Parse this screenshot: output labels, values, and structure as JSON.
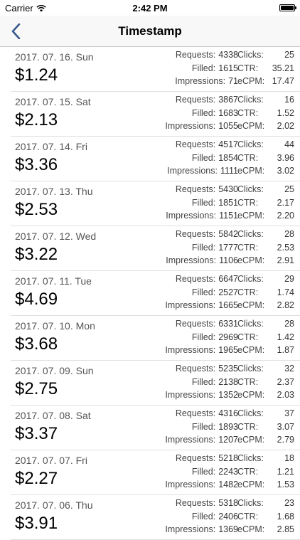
{
  "status": {
    "carrier": "Carrier",
    "time": "2:42 PM"
  },
  "nav": {
    "title": "Timestamp"
  },
  "labels": {
    "requests": "Requests:",
    "filled": "Filled:",
    "impressions": "Impressions:",
    "clicks": "Clicks:",
    "ctr": "CTR:",
    "ecpm": "eCPM:"
  },
  "rows": [
    {
      "date": "2017. 07. 16. Sun",
      "amount": "$1.24",
      "requests": "4338",
      "filled": "1615",
      "impressions": "71",
      "clicks": "25",
      "ctr": "35.21",
      "ecpm": "17.47"
    },
    {
      "date": "2017. 07. 15. Sat",
      "amount": "$2.13",
      "requests": "3867",
      "filled": "1683",
      "impressions": "1055",
      "clicks": "16",
      "ctr": "1.52",
      "ecpm": "2.02"
    },
    {
      "date": "2017. 07. 14. Fri",
      "amount": "$3.36",
      "requests": "4517",
      "filled": "1854",
      "impressions": "1111",
      "clicks": "44",
      "ctr": "3.96",
      "ecpm": "3.02"
    },
    {
      "date": "2017. 07. 13. Thu",
      "amount": "$2.53",
      "requests": "5430",
      "filled": "1851",
      "impressions": "1151",
      "clicks": "25",
      "ctr": "2.17",
      "ecpm": "2.20"
    },
    {
      "date": "2017. 07. 12. Wed",
      "amount": "$3.22",
      "requests": "5842",
      "filled": "1777",
      "impressions": "1106",
      "clicks": "28",
      "ctr": "2.53",
      "ecpm": "2.91"
    },
    {
      "date": "2017. 07. 11. Tue",
      "amount": "$4.69",
      "requests": "6647",
      "filled": "2527",
      "impressions": "1665",
      "clicks": "29",
      "ctr": "1.74",
      "ecpm": "2.82"
    },
    {
      "date": "2017. 07. 10. Mon",
      "amount": "$3.68",
      "requests": "6331",
      "filled": "2969",
      "impressions": "1965",
      "clicks": "28",
      "ctr": "1.42",
      "ecpm": "1.87"
    },
    {
      "date": "2017. 07. 09. Sun",
      "amount": "$2.75",
      "requests": "5235",
      "filled": "2138",
      "impressions": "1352",
      "clicks": "32",
      "ctr": "2.37",
      "ecpm": "2.03"
    },
    {
      "date": "2017. 07. 08. Sat",
      "amount": "$3.37",
      "requests": "4316",
      "filled": "1893",
      "impressions": "1207",
      "clicks": "37",
      "ctr": "3.07",
      "ecpm": "2.79"
    },
    {
      "date": "2017. 07. 07. Fri",
      "amount": "$2.27",
      "requests": "5218",
      "filled": "2243",
      "impressions": "1482",
      "clicks": "18",
      "ctr": "1.21",
      "ecpm": "1.53"
    },
    {
      "date": "2017. 07. 06. Thu",
      "amount": "$3.91",
      "requests": "5318",
      "filled": "2406",
      "impressions": "1369",
      "clicks": "23",
      "ctr": "1.68",
      "ecpm": "2.85"
    }
  ]
}
